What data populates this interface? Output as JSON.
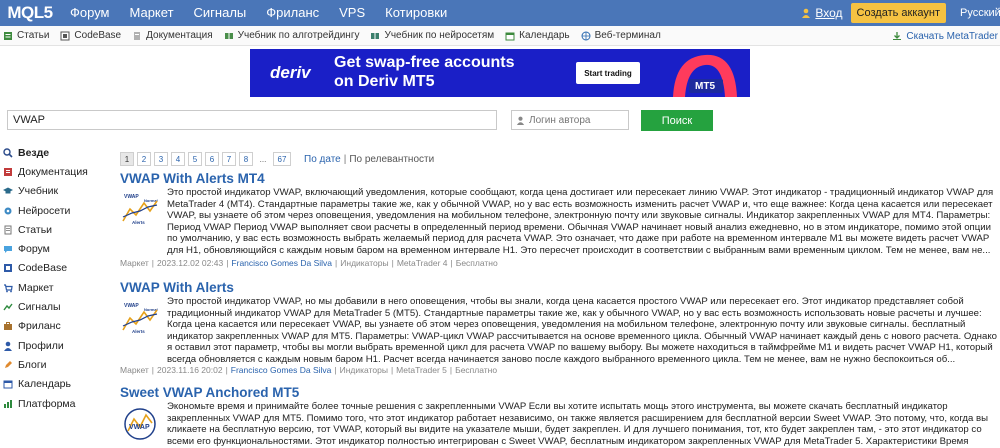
{
  "topnav": {
    "logo": "MQL5",
    "links": [
      "Форум",
      "Маркет",
      "Сигналы",
      "Фриланс",
      "VPS",
      "Котировки"
    ],
    "login": "Вход",
    "create_account": "Создать аккаунт",
    "language": "Русский"
  },
  "subnav": {
    "items": [
      "Статьи",
      "CodeBase",
      "Документация",
      "Учебник по алготрейдингу",
      "Учебник по нейросетям",
      "Календарь",
      "Веб-терминал"
    ],
    "download": "Скачать MetaTrader"
  },
  "banner": {
    "brand": "deriv",
    "headline_1": "Get swap-free accounts",
    "headline_2": "on Deriv MT5",
    "button": "Start trading",
    "badge": "MT5"
  },
  "search": {
    "query": "VWAP",
    "author_placeholder": "Логин автора",
    "button": "Поиск"
  },
  "sidebar": {
    "items": [
      "Везде",
      "Документация",
      "Учебник",
      "Нейросети",
      "Статьи",
      "Форум",
      "CodeBase",
      "Маркет",
      "Сигналы",
      "Фриланс",
      "Профили",
      "Блоги",
      "Календарь",
      "Платформа"
    ]
  },
  "pagination": {
    "pages": [
      "1",
      "2",
      "3",
      "4",
      "5",
      "6",
      "7",
      "8",
      "...",
      "67"
    ],
    "sort_by_date": "По дате",
    "sort_by_relevance": "По релевантности"
  },
  "results": [
    {
      "title": "VWAP With Alerts MT4",
      "thumb_top": "VWAP",
      "thumb_mid": "Normal",
      "thumb_bot": "Alerts",
      "description": "Это простой индикатор VWAP, включающий уведомления, которые сообщают, когда цена достигает или пересекает линию VWAP. Этот индикатор - традиционный индикатор VWAP для MetaTrader 4 (MT4). Стандартные параметры такие же, как у обычной VWAP, но у вас есть возможность изменить расчет VWAP и, что еще важнее: Когда цена касается или пересекает VWAP, вы узнаете об этом через оповещения, уведомления на мобильном телефоне, электронную почту или звуковые сигналы. Индикатор закрепленных VWAP для MT4. Параметры: Период VWAP Период VWAP выполняет свои расчеты в определенный период времени. Обычная VWAP начинает новый анализ ежедневно, но в этом индикаторе, помимо этой опции по умолчанию, у вас есть возможность выбрать желаемый период для расчета VWAP. Это означает, что даже при работе на временном интервале M1 вы можете видеть расчет VWAP для H1, обновляющийся с каждым новым баром на временном интервале H1. Это пересчет происходит в соответствии с выбранным вами временным циклом. Тем не менее, вам не...",
      "meta": {
        "section": "Маркет",
        "date": "2023.12.02 02:43",
        "author": "Francisco Gomes Da Silva",
        "category": "Индикаторы",
        "platform": "MetaTrader 4",
        "price": "Бесплатно"
      }
    },
    {
      "title": "VWAP With Alerts",
      "thumb_top": "VWAP",
      "thumb_mid": "Normal",
      "thumb_bot": "Alerts",
      "description": "Это простой индикатор VWAP, но мы добавили в него оповещения, чтобы вы знали, когда цена касается простого VWAP или пересекает его. Этот индикатор представляет собой традиционный индикатор VWAP для MetaTrader 5 (MT5). Стандартные параметры такие же, как у обычного VWAP, но у вас есть возможность использовать новые расчеты и лучшее: Когда цена касается или пересекает VWAP, вы узнаете об этом через оповещения, уведомления на мобильном телефоне, электронную почту или звуковые сигналы. бесплатный индикатор закрепленных VWAP для MT5. Параметры: VWAP-цикл VWAP рассчитывается на основе временного цикла. Обычный VWAP начинает каждый день с нового расчета. Однако я оставил этот параметр, чтобы вы могли выбрать временной цикл для расчета VWAP по вашему выбору. Вы можете находиться в таймфрейме M1 и видеть расчет VWAP H1, который всегда обновляется с каждым новым баром H1. Расчет всегда начинается заново после каждого выбранного временного цикла. Тем не менее, вам не нужно беспокоиться об...",
      "meta": {
        "section": "Маркет",
        "date": "2023.11.16 20:02",
        "author": "Francisco Gomes Da Silva",
        "category": "Индикаторы",
        "platform": "MetaTrader 5",
        "price": "Бесплатно"
      }
    },
    {
      "title": "Sweet VWAP Anchored MT5",
      "thumb_top": "",
      "thumb_mid": "VWAP",
      "thumb_bot": "",
      "description": "Экономьте время и принимайте более точные решения с закрепленными VWAP Если вы хотите испытать мощь этого инструмента, вы можете скачать бесплатный индикатор закрепленных VWAP для MT5. Помимо того, что этот индикатор работает независимо, он также является расширением для бесплатной версии Sweet VWAP. Это потому, что, когда вы кликаете на бесплатную версию, тот VWAP, который вы видите на указателе мыши, будет закреплен. И для лучшего понимания, тот, кто будет закреплен там, - это этот индикатор со всеми его функциональностями. Этот индикатор полностью интегрирован с Sweet VWAP, бесплатным индикатором закрепленных VWAP для MetaTrader 5. Характеристики Время закрепления Это свеча, к которой вы хотите закрепить свой VWAP.",
      "meta": {
        "section": "",
        "date": "",
        "author": "",
        "category": "",
        "platform": "",
        "price": ""
      }
    }
  ],
  "colors": {
    "nav_bg": "#4a76b8",
    "accent": "#2a63ad",
    "search_btn": "#25a23f",
    "create_btn": "#f5c242",
    "banner_bg": "#1a1fc7"
  }
}
